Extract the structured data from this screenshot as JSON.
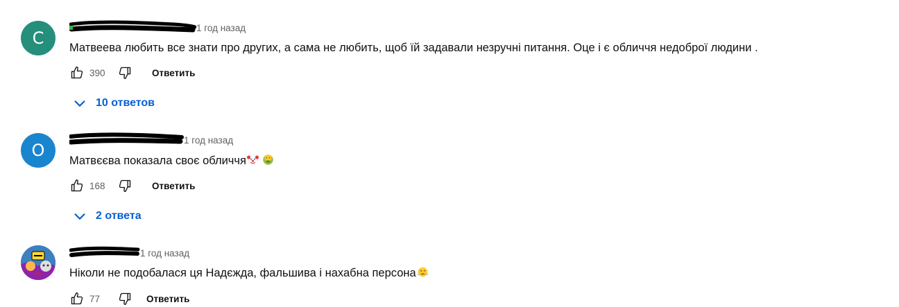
{
  "comments": [
    {
      "avatar_letter": "C",
      "avatar_color": "#258f7b",
      "time": "1 год назад",
      "text": "Матвеева любить все знати про других, а сама не любить, щоб їй задавали незручні питання. Оце і є обличчя недоброї  людини .",
      "likes": "390",
      "reply_label": "Ответить",
      "replies_label": "10 ответов"
    },
    {
      "avatar_letter": "O",
      "avatar_color": "#1a85cf",
      "time": "1 год назад",
      "text": "Матвєєва показала своє обличчя",
      "emojis": [
        "clown-face-emoji",
        "nauseated-face-emoji"
      ],
      "likes": "168",
      "reply_label": "Ответить",
      "replies_label": "2 ответа"
    },
    {
      "avatar_image": "brawl-stars-avatar",
      "time": "1 год назад",
      "text": "Ніколи не подобалася ця Надєжда, фальшива і нахабна персона",
      "emojis": [
        "face-with-steam-emoji"
      ],
      "likes": "77",
      "reply_label": "Ответить"
    }
  ],
  "icons": {
    "like": "thumbs-up-icon",
    "dislike": "thumbs-down-icon",
    "expand": "chevron-down-icon"
  },
  "colors": {
    "link_blue": "#065fd4",
    "secondary_text": "#606060"
  }
}
